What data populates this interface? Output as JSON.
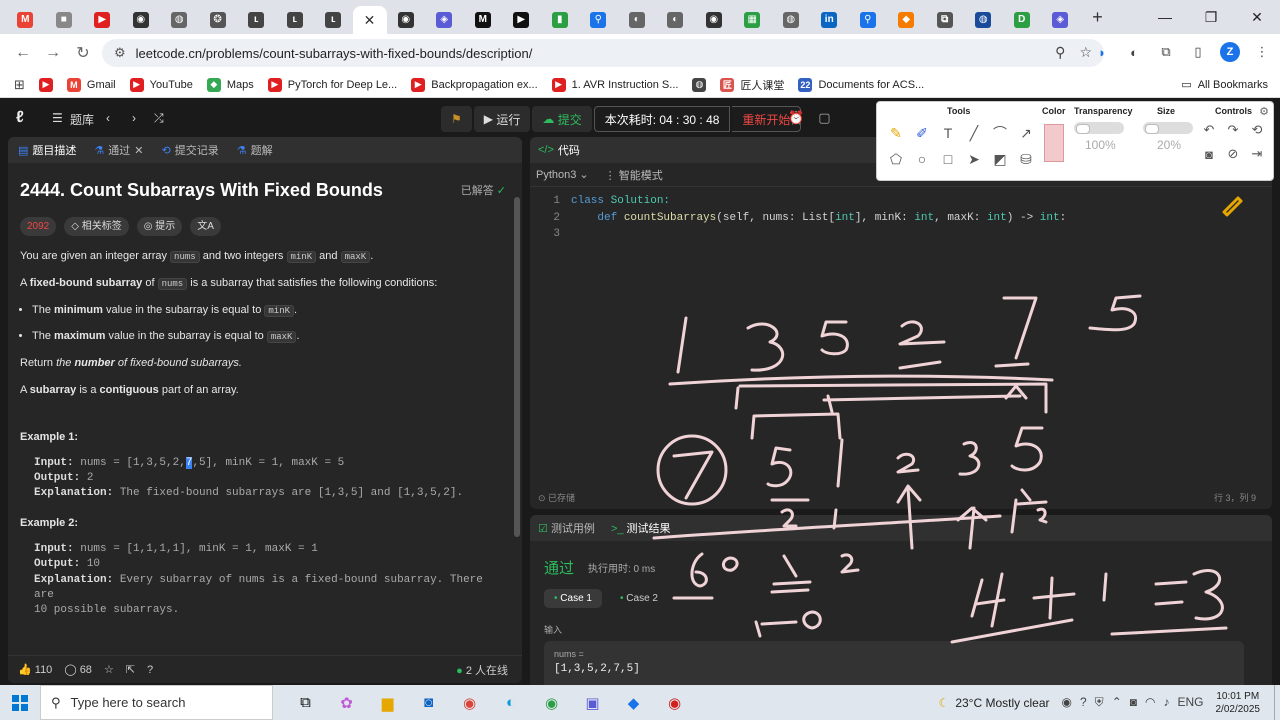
{
  "browser": {
    "url": "leetcode.cn/problems/count-subarrays-with-fixed-bounds/description/",
    "tabs": [
      {
        "icon": "M",
        "color": "#ea4335"
      },
      {
        "icon": "■",
        "color": "#888888"
      },
      {
        "icon": "▶",
        "color": "#e02020"
      },
      {
        "icon": "◉",
        "color": "#333333"
      },
      {
        "icon": "◍",
        "color": "#666666"
      },
      {
        "icon": "❂",
        "color": "#555555"
      },
      {
        "icon": "ʟ",
        "color": "#444444"
      },
      {
        "icon": "ʟ",
        "color": "#444444"
      },
      {
        "icon": "ʟ",
        "color": "#444444"
      },
      {
        "icon": "✕",
        "color": "#333333"
      },
      {
        "icon": "◉",
        "color": "#333333"
      },
      {
        "icon": "◈",
        "color": "#5b5bd6"
      },
      {
        "icon": "M",
        "color": "#111111"
      },
      {
        "icon": "▶",
        "color": "#111111"
      },
      {
        "icon": "▮",
        "color": "#2c9f45"
      },
      {
        "icon": "⚲",
        "color": "#1a73e8"
      },
      {
        "icon": "◐",
        "color": "#666666"
      },
      {
        "icon": "◐",
        "color": "#666666"
      },
      {
        "icon": "◉",
        "color": "#333333"
      },
      {
        "icon": "▦",
        "color": "#2c9f45"
      },
      {
        "icon": "◍",
        "color": "#666666"
      },
      {
        "icon": "in",
        "color": "#0a66c2"
      },
      {
        "icon": "⚲",
        "color": "#1a73e8"
      },
      {
        "icon": "◆",
        "color": "#f57c00"
      },
      {
        "icon": "⧉",
        "color": "#555555"
      },
      {
        "icon": "◍",
        "color": "#1a4b9b"
      },
      {
        "icon": "D",
        "color": "#2c9f45"
      },
      {
        "icon": "◈",
        "color": "#5b5bd6"
      }
    ],
    "bookmarks": [
      {
        "label": "",
        "color": "#e02020",
        "icon": "▶"
      },
      {
        "label": "Gmail",
        "color": "#ea4335",
        "icon": "M"
      },
      {
        "label": "YouTube",
        "color": "#e02020",
        "icon": "▶"
      },
      {
        "label": "Maps",
        "color": "#34a853",
        "icon": "◆"
      },
      {
        "label": "PyTorch for Deep Le...",
        "color": "#e02020",
        "icon": "▶"
      },
      {
        "label": "Backpropagation ex...",
        "color": "#e02020",
        "icon": "▶"
      },
      {
        "label": "1. AVR Instruction S...",
        "color": "#e02020",
        "icon": "▶"
      },
      {
        "label": "",
        "color": "#444444",
        "icon": "◍"
      },
      {
        "label": "匠人课堂",
        "color": "#d9534f",
        "icon": "匠"
      },
      {
        "label": "Documents for ACS...",
        "color": "#3461c1",
        "icon": "22"
      }
    ],
    "all_bookmarks": "All Bookmarks"
  },
  "lc": {
    "problem_bank": "题库",
    "run": "运行",
    "submit": "提交",
    "timer": "本次耗时: 04 : 30 : 48",
    "restart": "重新开始",
    "left_tabs": [
      "题目描述",
      "通过",
      "提交记录",
      "题解"
    ],
    "title": "2444. Count Subarrays With Fixed Bounds",
    "solved": "已解答",
    "difficulty_count": "2092",
    "tag_related": "相关标签",
    "tag_hint": "提示",
    "tag_lang": "文A",
    "p1_a": "You are given an integer array",
    "p1_code1": "nums",
    "p1_b": "and two integers",
    "p1_code2": "minK",
    "p1_c": "and",
    "p1_code3": "maxK",
    "p1_d": ".",
    "p2_a": "A",
    "p2_b": "fixed-bound subarray",
    "p2_c": "of",
    "p2_code": "nums",
    "p2_d": "is a subarray that satisfies the following conditions:",
    "li1_a": "The",
    "li1_b": "minimum",
    "li1_c": "value in the subarray is equal to",
    "li1_code": "minK",
    "li2_a": "The",
    "li2_b": "maximum",
    "li2_c": "value in the subarray is equal to",
    "li2_code": "maxK",
    "p3_a": "Return",
    "p3_b": "the",
    "p3_c": "number",
    "p3_d": "of fixed-bound subarrays.",
    "p4_a": "A",
    "p4_b": "subarray",
    "p4_c": "is a",
    "p4_d": "contiguous",
    "p4_e": "part of an array.",
    "ex1_h": "Example 1:",
    "ex1_input_label": "Input:",
    "ex1_input_pre": "nums = [1,3,5,2,",
    "ex1_input_hl": "7",
    "ex1_input_post": ",5], minK = 1, maxK = 5",
    "ex1_output_label": "Output:",
    "ex1_output": "2",
    "ex1_expl_label": "Explanation:",
    "ex1_expl": "The fixed-bound subarrays are [1,3,5] and [1,3,5,2].",
    "ex2_h": "Example 2:",
    "ex2_input_label": "Input:",
    "ex2_input": "nums = [1,1,1,1], minK = 1, maxK = 1",
    "ex2_output_label": "Output:",
    "ex2_output": "10",
    "ex2_expl_label": "Explanation:",
    "ex2_expl1": "Every subarray of nums is a fixed-bound subarray. There are",
    "ex2_expl2": "10 possible subarrays.",
    "likes": "110",
    "comments": "68",
    "online": "2 人在线",
    "code_tab": "代码",
    "lang": "Python3",
    "smart_mode": "智能模式",
    "code_lines": [
      {
        "n": "1",
        "text": ""
      },
      {
        "n": "2",
        "text": ""
      },
      {
        "n": "3",
        "text": ""
      }
    ],
    "code_l1_kw": "class",
    "code_l1_name": "Solution:",
    "code_l2_kw": "def",
    "code_l2_fn": "countSubarrays",
    "code_l2_a": "(self, nums: List[",
    "code_l2_t1": "int",
    "code_l2_b": "], minK:",
    "code_l2_t2": "int",
    "code_l2_c": ", maxK:",
    "code_l2_t3": "int",
    "code_l2_d": ") ->",
    "code_l2_t4": "int",
    "code_l2_e": ":",
    "saved": "已存储",
    "cursor_pos": "行 3，列 9",
    "result_tabs": [
      "测试用例",
      "测试结果"
    ],
    "pass": "通过",
    "runtime": "执行用时: 0 ms",
    "cases": [
      "Case 1",
      "Case 2"
    ],
    "input_label": "输入",
    "input_var": "nums =",
    "input_val": "[1,3,5,2,7,5]"
  },
  "drawtools": {
    "tools": "Tools",
    "color": "Color",
    "transparency": "Transparency",
    "transparency_val": "100%",
    "size": "Size",
    "size_val": "20%",
    "controls": "Controls",
    "swatch_color": "#f2c9cd"
  },
  "taskbar": {
    "search_placeholder": "Type here to search",
    "weather": "23°C  Mostly clear",
    "lang": "ENG",
    "time": "10:01 PM",
    "date": "2/02/2025"
  }
}
